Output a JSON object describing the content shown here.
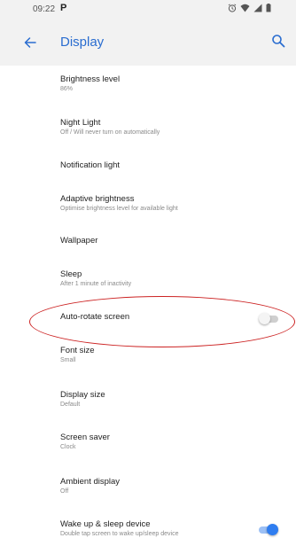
{
  "status_bar": {
    "time": "09:22",
    "app_icon": "P",
    "icons": [
      "alarm-icon",
      "wifi-icon",
      "signal-icon",
      "battery-icon"
    ]
  },
  "app_bar": {
    "title": "Display",
    "back_icon": "arrow-left-icon",
    "search_icon": "search-icon",
    "accent_color": "#2a6dd0"
  },
  "settings": [
    {
      "title": "Brightness level",
      "summary": "86%"
    },
    {
      "title": "Night Light",
      "summary": "Off / Will never turn on automatically"
    },
    {
      "title": "Notification light",
      "summary": ""
    },
    {
      "title": "Adaptive brightness",
      "summary": "Optimise brightness level for available light"
    },
    {
      "title": "Wallpaper",
      "summary": ""
    },
    {
      "title": "Sleep",
      "summary": "After 1 minute of inactivity"
    },
    {
      "title": "Auto-rotate screen",
      "summary": "",
      "toggle": "off"
    },
    {
      "title": "Font size",
      "summary": "Small"
    },
    {
      "title": "Display size",
      "summary": "Default"
    },
    {
      "title": "Screen saver",
      "summary": "Clock"
    },
    {
      "title": "Ambient display",
      "summary": "Off"
    },
    {
      "title": "Wake up & sleep device",
      "summary": "Double tap screen to wake up/sleep device",
      "toggle": "on"
    }
  ],
  "colors": {
    "toggle_on": "#2f7df0",
    "toggle_off": "#cfcfcf",
    "annotation": "#cc2222"
  }
}
